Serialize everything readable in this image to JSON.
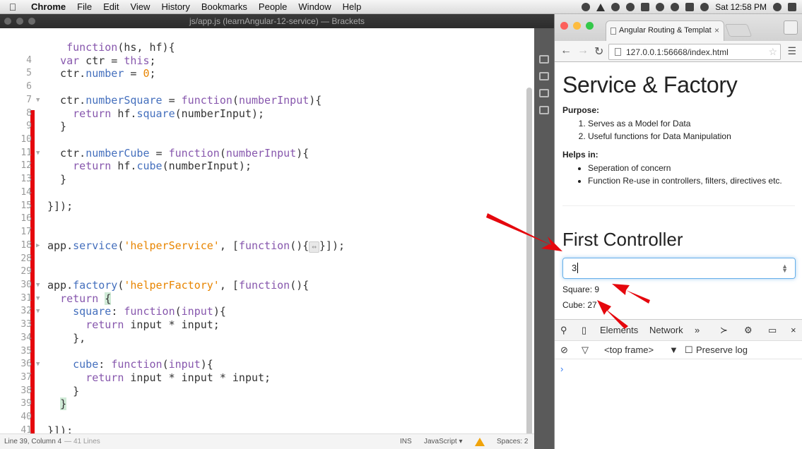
{
  "menubar": {
    "app": "Chrome",
    "items": [
      "File",
      "Edit",
      "View",
      "History",
      "Bookmarks",
      "People",
      "Window",
      "Help"
    ],
    "clock": "Sat 12:58 PM"
  },
  "brackets": {
    "title": "js/app.js (learnAngular-12-service) — Brackets",
    "status": {
      "position": "Line 39, Column 4",
      "lines": "— 41 Lines",
      "mode": "INS",
      "language": "JavaScript",
      "spaces": "Spaces: 2"
    }
  },
  "chrome": {
    "tab_title": "Angular Routing & Templat",
    "url": "127.0.0.1:56668/index.html"
  },
  "page": {
    "heading": "Service & Factory",
    "purpose_label": "Purpose:",
    "purpose_items": [
      "Serves as a Model for Data",
      "Useful functions for Data Manipulation"
    ],
    "helps_label": "Helps in:",
    "helps_items": [
      "Seperation of concern",
      "Function Re-use in controllers, filters, directives etc."
    ],
    "controller_heading": "First Controller",
    "input_value": "3",
    "square": "Square: 9",
    "cube": "Cube: 27"
  },
  "devtools": {
    "tabs": [
      "Elements",
      "Network"
    ],
    "frame": "<top frame>",
    "preserve_log": "Preserve log",
    "console_prompt": "›"
  },
  "colors": {
    "annotation_red": "#e5070d",
    "chrome_close": "#fc605c",
    "chrome_min": "#fdbc40",
    "chrome_max": "#34c84a"
  }
}
